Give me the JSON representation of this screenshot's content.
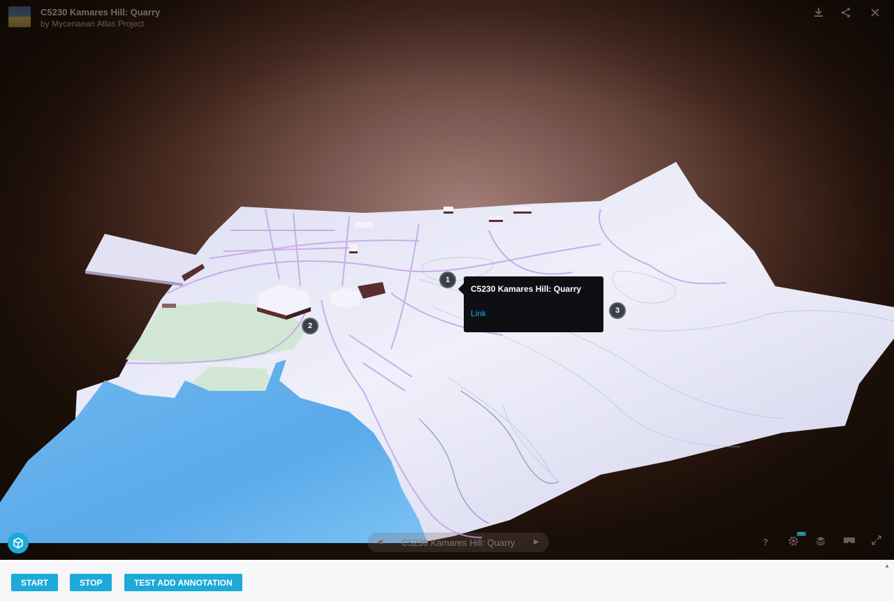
{
  "header": {
    "title": "C5230 Kamares Hill: Quarry",
    "author": "by Mycenaean Atlas Project",
    "icons": [
      "download-icon",
      "share-icon",
      "close-icon"
    ]
  },
  "hotspots": [
    {
      "label": "1"
    },
    {
      "label": "2"
    },
    {
      "label": "3"
    }
  ],
  "tooltip": {
    "title": "C5230 Kamares Hill: Quarry",
    "link": "Link"
  },
  "annotation_nav": {
    "label": "C5230 Kamares Hill: Quarry",
    "prev_icon": "chevron-left-icon",
    "next_icon": "chevron-right-icon"
  },
  "controls": {
    "help": "?",
    "hd_badge": "HD",
    "icons": [
      "help-icon",
      "settings-icon",
      "layers-icon",
      "vr-icon",
      "fullscreen-icon"
    ]
  },
  "buttons": {
    "start": "START",
    "stop": "STOP",
    "test": "TEST ADD ANNOTATION"
  },
  "colors": {
    "accent": "#1caad9",
    "tooltip_bg": "#0d0f13",
    "water": "#5aa9ea",
    "terrain": "#e6e7f7",
    "park": "#cfe6d2",
    "roads": "#c8a6e6"
  }
}
